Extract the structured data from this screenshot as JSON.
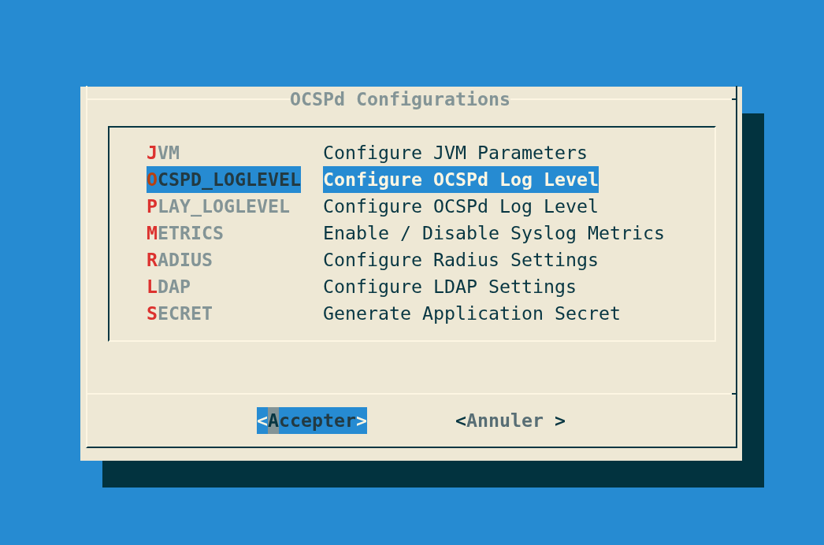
{
  "dialog": {
    "title": "OCSPd Configurations"
  },
  "menu": {
    "items": [
      {
        "tag": "JVM",
        "description": "Configure JVM Parameters",
        "selected": false
      },
      {
        "tag": "OCSPD_LOGLEVEL",
        "description": "Configure OCSPd Log Level",
        "selected": true
      },
      {
        "tag": "PLAY_LOGLEVEL",
        "description": "Configure OCSPd Log Level",
        "selected": false
      },
      {
        "tag": "METRICS",
        "description": "Enable / Disable Syslog Metrics",
        "selected": false
      },
      {
        "tag": "RADIUS",
        "description": "Configure Radius Settings",
        "selected": false
      },
      {
        "tag": "LDAP",
        "description": "Configure LDAP Settings",
        "selected": false
      },
      {
        "tag": "SECRET",
        "description": "Generate Application Secret",
        "selected": false
      }
    ]
  },
  "buttons": [
    {
      "label": "<Accepter>",
      "selected": true
    },
    {
      "label": "<Annuler >",
      "selected": false
    }
  ]
}
